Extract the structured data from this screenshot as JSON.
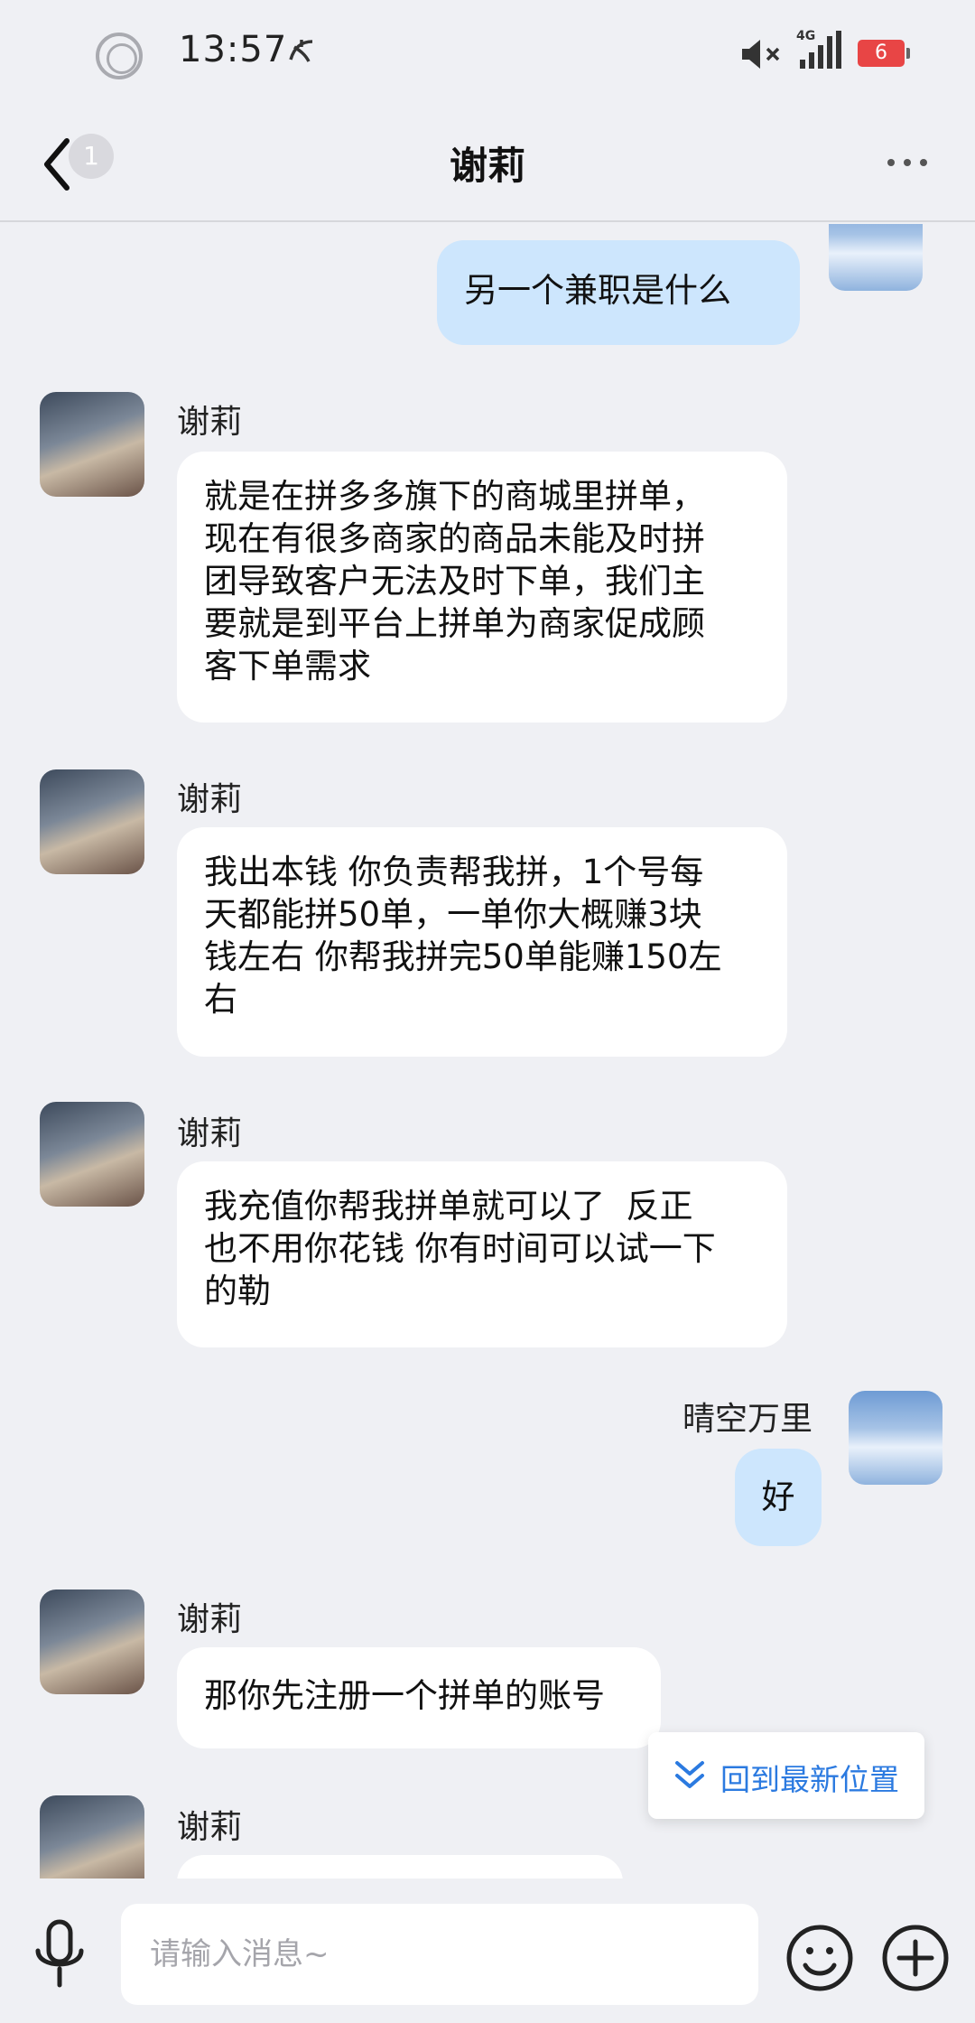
{
  "status_bar": {
    "time": "13:57",
    "network": "4G",
    "battery": "6"
  },
  "nav": {
    "title": "谢莉",
    "unread_badge": "1"
  },
  "messages": [
    {
      "from": "me",
      "sender": "",
      "text": "另一个兼职是什么"
    },
    {
      "from": "her",
      "sender": "谢莉",
      "text": "就是在拼多多旗下的商城里拼单，\n现在有很多商家的商品未能及时拼\n团导致客户无法及时下单，我们主\n要就是到平台上拼单为商家促成顾\n客下单需求"
    },
    {
      "from": "her",
      "sender": "谢莉",
      "text": "我出本钱 你负责帮我拼，1个号每\n天都能拼50单，一单你大概赚3块\n钱左右 你帮我拼完50单能赚150左\n右"
    },
    {
      "from": "her",
      "sender": "谢莉",
      "text": "我充值你帮我拼单就可以了  反正\n也不用你花钱 你有时间可以试一下\n的勒"
    },
    {
      "from": "me",
      "sender": "晴空万里",
      "text": "好"
    },
    {
      "from": "her",
      "sender": "谢莉",
      "text": "那你先注册一个拼单的账号"
    },
    {
      "from": "her",
      "sender": "谢莉",
      "text": ""
    }
  ],
  "jump_latest": {
    "label": "回到最新位置"
  },
  "input": {
    "placeholder": "请输入消息~"
  },
  "colors": {
    "background": "#eff0f4",
    "my_bubble": "#cde6fd",
    "their_bubble": "#ffffff",
    "accent": "#2b7ae0",
    "battery": "#e84545"
  },
  "icons": {
    "back": "back-chevron-icon",
    "more": "more-dots-icon",
    "mic": "microphone-icon",
    "emoji": "emoji-icon",
    "plus": "plus-circle-icon",
    "jump": "double-chevron-down-icon"
  }
}
